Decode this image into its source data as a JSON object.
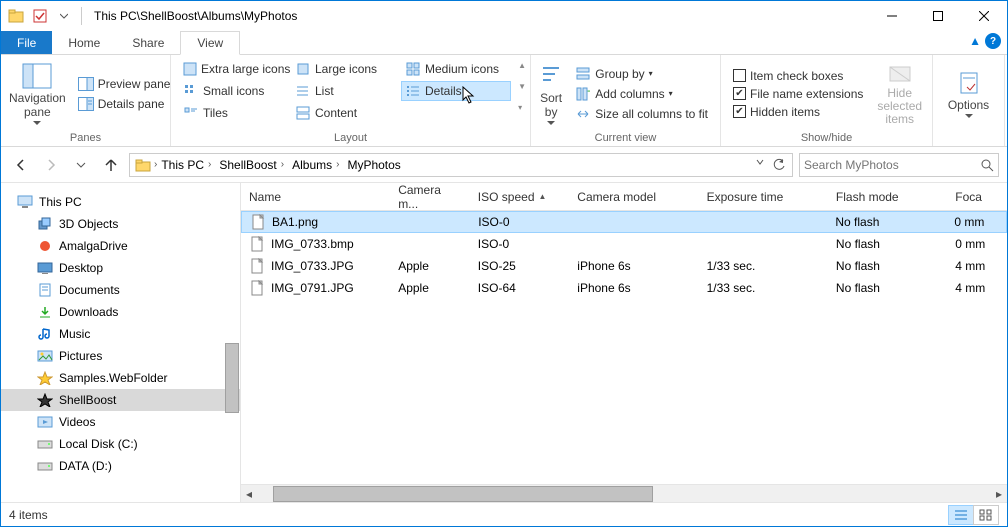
{
  "title": "This PC\\ShellBoost\\Albums\\MyPhotos",
  "tabs": {
    "file": "File",
    "home": "Home",
    "share": "Share",
    "view": "View"
  },
  "ribbon": {
    "panes": {
      "navigation": "Navigation pane",
      "preview": "Preview pane",
      "details": "Details pane",
      "group": "Panes"
    },
    "layout": {
      "xl": "Extra large icons",
      "large": "Large icons",
      "medium": "Medium icons",
      "small": "Small icons",
      "list": "List",
      "details": "Details",
      "tiles": "Tiles",
      "content": "Content",
      "group": "Layout"
    },
    "current": {
      "sort": "Sort by",
      "groupby": "Group by",
      "addcols": "Add columns",
      "sizeall": "Size all columns to fit",
      "group": "Current view"
    },
    "showhide": {
      "itemcheck": "Item check boxes",
      "fileext": "File name extensions",
      "hidden": "Hidden items",
      "hidesel": "Hide selected items",
      "group": "Show/hide"
    },
    "options": "Options"
  },
  "breadcrumb": [
    "This PC",
    "ShellBoost",
    "Albums",
    "MyPhotos"
  ],
  "search_placeholder": "Search MyPhotos",
  "tree": {
    "thispc": "This PC",
    "items": [
      "3D Objects",
      "AmalgaDrive",
      "Desktop",
      "Documents",
      "Downloads",
      "Music",
      "Pictures",
      "Samples.WebFolder",
      "ShellBoost",
      "Videos",
      "Local Disk (C:)",
      "DATA (D:)"
    ],
    "selected": "ShellBoost"
  },
  "columns": [
    "Name",
    "Camera m...",
    "ISO speed",
    "Camera model",
    "Exposure time",
    "Flash mode",
    "Foca"
  ],
  "sort_col": "ISO speed",
  "rows": [
    {
      "name": "BA1.png",
      "cm": "",
      "iso": "ISO-0",
      "model": "",
      "exp": "",
      "flash": "No flash",
      "focal": "0 mm",
      "selected": true
    },
    {
      "name": "IMG_0733.bmp",
      "cm": "",
      "iso": "ISO-0",
      "model": "",
      "exp": "",
      "flash": "No flash",
      "focal": "0 mm"
    },
    {
      "name": "IMG_0733.JPG",
      "cm": "Apple",
      "iso": "ISO-25",
      "model": "iPhone 6s",
      "exp": "1/33 sec.",
      "flash": "No flash",
      "focal": "4 mm"
    },
    {
      "name": "IMG_0791.JPG",
      "cm": "Apple",
      "iso": "ISO-64",
      "model": "iPhone 6s",
      "exp": "1/33 sec.",
      "flash": "No flash",
      "focal": "4 mm"
    }
  ],
  "status": "4 items"
}
